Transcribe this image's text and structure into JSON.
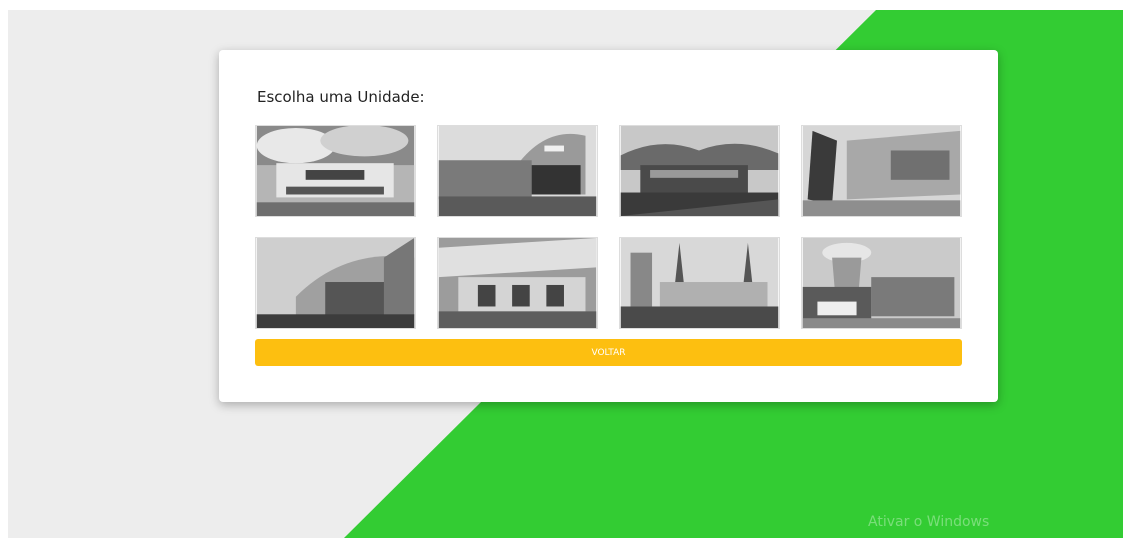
{
  "page": {
    "background_color": "#ededed",
    "accent_green": "#33cc33"
  },
  "unit_selector": {
    "title": "Escolha uma Unidade:",
    "units": [
      {
        "icon": "campus-building-photo"
      },
      {
        "icon": "campus-building-photo"
      },
      {
        "icon": "campus-building-photo"
      },
      {
        "icon": "campus-building-photo"
      },
      {
        "icon": "campus-building-photo"
      },
      {
        "icon": "campus-building-photo"
      },
      {
        "icon": "campus-building-photo"
      },
      {
        "icon": "campus-building-photo"
      }
    ],
    "back_button": {
      "label": "VOLTAR",
      "color": "#fdbf10"
    }
  },
  "os_overlay": {
    "watermark": "Ativar o Windows"
  }
}
